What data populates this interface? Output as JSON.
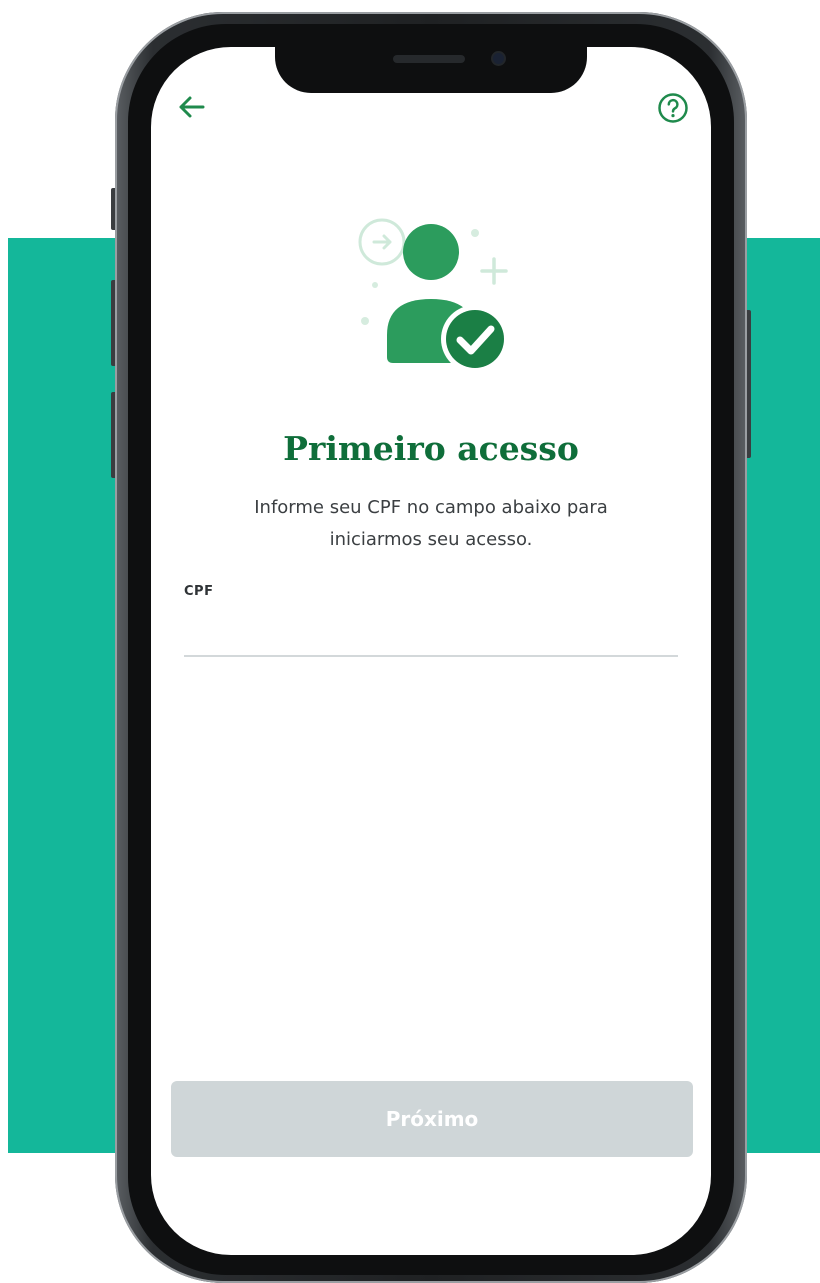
{
  "screen": {
    "title": "Primeiro acesso",
    "subtitle": "Informe seu CPF no campo abaixo para iniciarmos seu acesso.",
    "cpf_field": {
      "label": "CPF",
      "value": "",
      "placeholder": ""
    },
    "next_button_label": "Próximo",
    "next_button_enabled": false
  },
  "icons": {
    "back": "arrow-left-icon",
    "help": "help-circle-icon",
    "illustration": "user-check-icon"
  },
  "colors": {
    "brand_green": "#0f6e3a",
    "accent_green": "#2fa866",
    "background_teal": "#14b79a",
    "disabled_button": "#cfd6d8"
  }
}
